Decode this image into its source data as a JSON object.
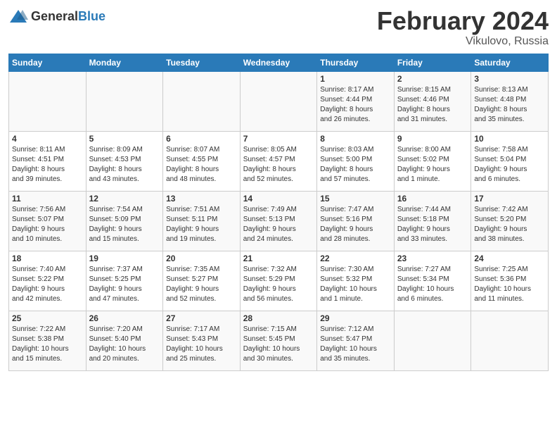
{
  "header": {
    "logo_general": "General",
    "logo_blue": "Blue",
    "title": "February 2024",
    "location": "Vikulovo, Russia"
  },
  "calendar": {
    "weekdays": [
      "Sunday",
      "Monday",
      "Tuesday",
      "Wednesday",
      "Thursday",
      "Friday",
      "Saturday"
    ],
    "weeks": [
      [
        {
          "day": "",
          "info": ""
        },
        {
          "day": "",
          "info": ""
        },
        {
          "day": "",
          "info": ""
        },
        {
          "day": "",
          "info": ""
        },
        {
          "day": "1",
          "info": "Sunrise: 8:17 AM\nSunset: 4:44 PM\nDaylight: 8 hours\nand 26 minutes."
        },
        {
          "day": "2",
          "info": "Sunrise: 8:15 AM\nSunset: 4:46 PM\nDaylight: 8 hours\nand 31 minutes."
        },
        {
          "day": "3",
          "info": "Sunrise: 8:13 AM\nSunset: 4:48 PM\nDaylight: 8 hours\nand 35 minutes."
        }
      ],
      [
        {
          "day": "4",
          "info": "Sunrise: 8:11 AM\nSunset: 4:51 PM\nDaylight: 8 hours\nand 39 minutes."
        },
        {
          "day": "5",
          "info": "Sunrise: 8:09 AM\nSunset: 4:53 PM\nDaylight: 8 hours\nand 43 minutes."
        },
        {
          "day": "6",
          "info": "Sunrise: 8:07 AM\nSunset: 4:55 PM\nDaylight: 8 hours\nand 48 minutes."
        },
        {
          "day": "7",
          "info": "Sunrise: 8:05 AM\nSunset: 4:57 PM\nDaylight: 8 hours\nand 52 minutes."
        },
        {
          "day": "8",
          "info": "Sunrise: 8:03 AM\nSunset: 5:00 PM\nDaylight: 8 hours\nand 57 minutes."
        },
        {
          "day": "9",
          "info": "Sunrise: 8:00 AM\nSunset: 5:02 PM\nDaylight: 9 hours\nand 1 minute."
        },
        {
          "day": "10",
          "info": "Sunrise: 7:58 AM\nSunset: 5:04 PM\nDaylight: 9 hours\nand 6 minutes."
        }
      ],
      [
        {
          "day": "11",
          "info": "Sunrise: 7:56 AM\nSunset: 5:07 PM\nDaylight: 9 hours\nand 10 minutes."
        },
        {
          "day": "12",
          "info": "Sunrise: 7:54 AM\nSunset: 5:09 PM\nDaylight: 9 hours\nand 15 minutes."
        },
        {
          "day": "13",
          "info": "Sunrise: 7:51 AM\nSunset: 5:11 PM\nDaylight: 9 hours\nand 19 minutes."
        },
        {
          "day": "14",
          "info": "Sunrise: 7:49 AM\nSunset: 5:13 PM\nDaylight: 9 hours\nand 24 minutes."
        },
        {
          "day": "15",
          "info": "Sunrise: 7:47 AM\nSunset: 5:16 PM\nDaylight: 9 hours\nand 28 minutes."
        },
        {
          "day": "16",
          "info": "Sunrise: 7:44 AM\nSunset: 5:18 PM\nDaylight: 9 hours\nand 33 minutes."
        },
        {
          "day": "17",
          "info": "Sunrise: 7:42 AM\nSunset: 5:20 PM\nDaylight: 9 hours\nand 38 minutes."
        }
      ],
      [
        {
          "day": "18",
          "info": "Sunrise: 7:40 AM\nSunset: 5:22 PM\nDaylight: 9 hours\nand 42 minutes."
        },
        {
          "day": "19",
          "info": "Sunrise: 7:37 AM\nSunset: 5:25 PM\nDaylight: 9 hours\nand 47 minutes."
        },
        {
          "day": "20",
          "info": "Sunrise: 7:35 AM\nSunset: 5:27 PM\nDaylight: 9 hours\nand 52 minutes."
        },
        {
          "day": "21",
          "info": "Sunrise: 7:32 AM\nSunset: 5:29 PM\nDaylight: 9 hours\nand 56 minutes."
        },
        {
          "day": "22",
          "info": "Sunrise: 7:30 AM\nSunset: 5:32 PM\nDaylight: 10 hours\nand 1 minute."
        },
        {
          "day": "23",
          "info": "Sunrise: 7:27 AM\nSunset: 5:34 PM\nDaylight: 10 hours\nand 6 minutes."
        },
        {
          "day": "24",
          "info": "Sunrise: 7:25 AM\nSunset: 5:36 PM\nDaylight: 10 hours\nand 11 minutes."
        }
      ],
      [
        {
          "day": "25",
          "info": "Sunrise: 7:22 AM\nSunset: 5:38 PM\nDaylight: 10 hours\nand 15 minutes."
        },
        {
          "day": "26",
          "info": "Sunrise: 7:20 AM\nSunset: 5:40 PM\nDaylight: 10 hours\nand 20 minutes."
        },
        {
          "day": "27",
          "info": "Sunrise: 7:17 AM\nSunset: 5:43 PM\nDaylight: 10 hours\nand 25 minutes."
        },
        {
          "day": "28",
          "info": "Sunrise: 7:15 AM\nSunset: 5:45 PM\nDaylight: 10 hours\nand 30 minutes."
        },
        {
          "day": "29",
          "info": "Sunrise: 7:12 AM\nSunset: 5:47 PM\nDaylight: 10 hours\nand 35 minutes."
        },
        {
          "day": "",
          "info": ""
        },
        {
          "day": "",
          "info": ""
        }
      ]
    ]
  }
}
